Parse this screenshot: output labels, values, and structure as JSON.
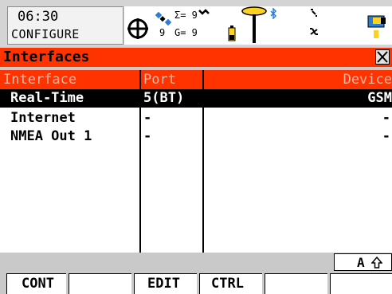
{
  "status": {
    "time": "06:30",
    "mode": "CONFIGURE",
    "satellites_total": "Σ= 9",
    "satellites_visible": "9",
    "glonass_count": "G= 9"
  },
  "title": "Interfaces",
  "table": {
    "headers": [
      "Interface",
      "Port",
      "Device"
    ],
    "rows": [
      {
        "interface": "Real-Time",
        "port": "5(BT)",
        "device": "GSM"
      },
      {
        "interface": "Internet",
        "port": "-",
        "device": "-"
      },
      {
        "interface": "NMEA Out 1",
        "port": "-",
        "device": "-"
      }
    ]
  },
  "input_mode": "A",
  "softkeys": [
    "CONT",
    "",
    "EDIT",
    "CTRL",
    "",
    ""
  ],
  "colors": {
    "accent": "#ff3300",
    "header_text": "#ffb3a0",
    "selection": "#000000"
  }
}
